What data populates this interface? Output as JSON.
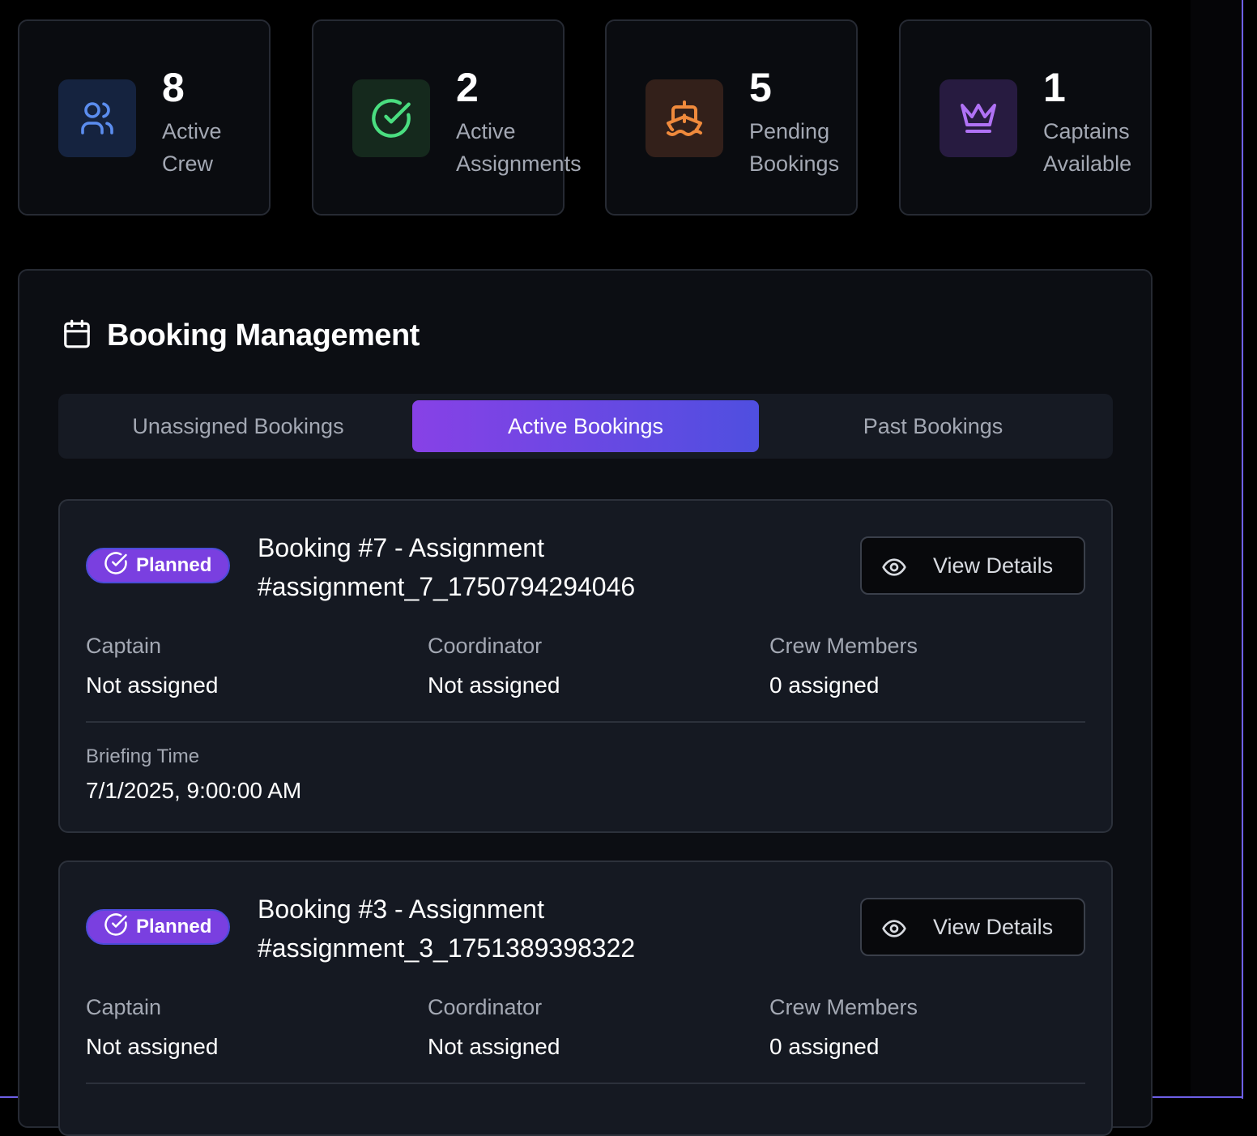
{
  "stats": [
    {
      "number": "8",
      "label_line1": "Active",
      "label_line2": "Crew",
      "icon": "users-icon",
      "color": "#5b8def",
      "bg": "#15233f"
    },
    {
      "number": "2",
      "label_line1": "Active",
      "label_line2": "Assignments",
      "icon": "check-circle-icon",
      "color": "#4ade80",
      "bg": "#15291d"
    },
    {
      "number": "5",
      "label_line1": "Pending",
      "label_line2": "Bookings",
      "icon": "ship-icon",
      "color": "#f08a3c",
      "bg": "#33201a"
    },
    {
      "number": "1",
      "label_line1": "Captains",
      "label_line2": "Available",
      "icon": "crown-icon",
      "color": "#b072f5",
      "bg": "#271b40"
    }
  ],
  "panel": {
    "title": "Booking Management",
    "title_icon": "calendar-icon"
  },
  "tabs": [
    {
      "label": "Unassigned Bookings",
      "active": false
    },
    {
      "label": "Active Bookings",
      "active": true
    },
    {
      "label": "Past Bookings",
      "active": false
    }
  ],
  "bookings": [
    {
      "status": "Planned",
      "title_line1": "Booking #7 - Assignment",
      "title_line2": "#assignment_7_1750794294046",
      "view_label": "View Details",
      "captain_label": "Captain",
      "captain_value": "Not assigned",
      "coordinator_label": "Coordinator",
      "coordinator_value": "Not assigned",
      "crew_label": "Crew Members",
      "crew_value": "0 assigned",
      "briefing_label": "Briefing Time",
      "briefing_value": "7/1/2025, 9:00:00 AM"
    },
    {
      "status": "Planned",
      "title_line1": "Booking #3 - Assignment",
      "title_line2": "#assignment_3_1751389398322",
      "view_label": "View Details",
      "captain_label": "Captain",
      "captain_value": "Not assigned",
      "coordinator_label": "Coordinator",
      "coordinator_value": "Not assigned",
      "crew_label": "Crew Members",
      "crew_value": "0 assigned"
    }
  ],
  "colors": {
    "accent_gradient_start": "#8741e6",
    "accent_gradient_end": "#4f4fe0",
    "frame_edge": "#6d5fe6"
  }
}
